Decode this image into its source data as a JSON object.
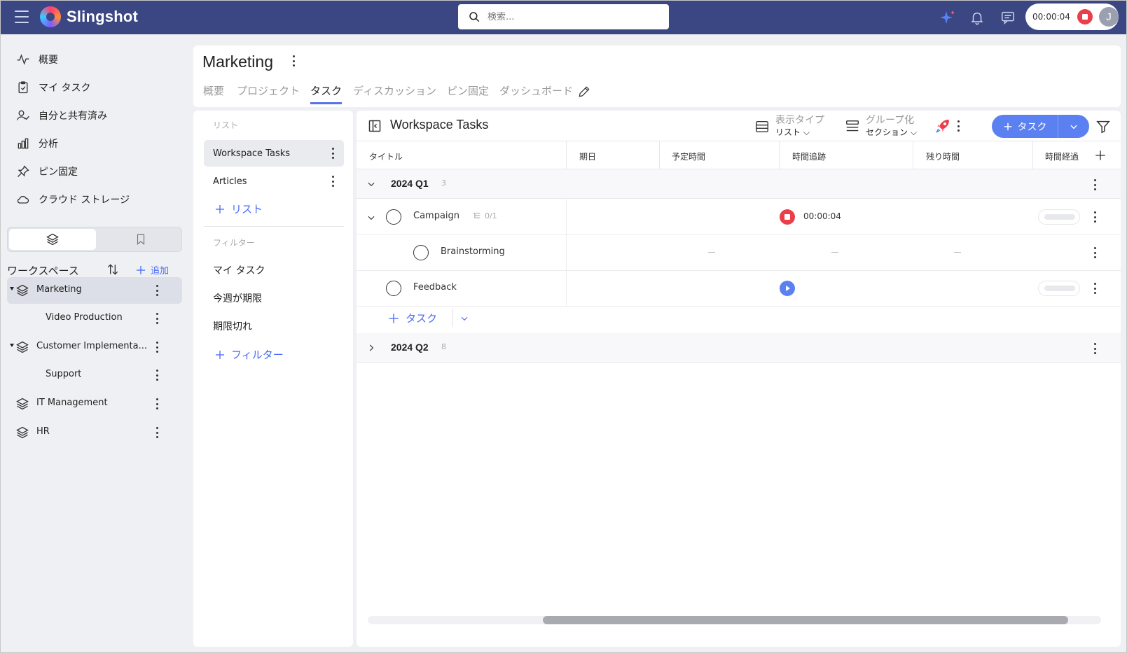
{
  "app": {
    "name": "Slingshot",
    "search_placeholder": "検索...",
    "timer": "00:00:04",
    "avatar_initial": "J"
  },
  "colors": {
    "topbar": "#3b4782",
    "accent": "#5b80f2",
    "record": "#ea3f4b"
  },
  "sidebar": {
    "nav": [
      {
        "label": "概要",
        "icon": "activity-icon"
      },
      {
        "label": "マイ タスク",
        "icon": "clipboard-check-icon"
      },
      {
        "label": "自分と共有済み",
        "icon": "user-check-icon"
      },
      {
        "label": "分析",
        "icon": "bar-chart-icon"
      },
      {
        "label": "ピン固定",
        "icon": "pin-icon"
      },
      {
        "label": "クラウド ストレージ",
        "icon": "cloud-icon"
      }
    ],
    "workspace_title": "ワークスペース",
    "add_label": "追加",
    "workspaces": [
      {
        "label": "Marketing",
        "active": true,
        "expanded": true,
        "sub": false
      },
      {
        "label": "Video Production",
        "sub": true
      },
      {
        "label": "Customer Implementa...",
        "expanded": true,
        "sub": false
      },
      {
        "label": "Support",
        "sub": true
      },
      {
        "label": "IT Management",
        "sub": false
      },
      {
        "label": "HR",
        "sub": false
      }
    ]
  },
  "header": {
    "title": "Marketing",
    "tabs": [
      {
        "label": "概要"
      },
      {
        "label": "プロジェクト"
      },
      {
        "label": "タスク",
        "active": true
      },
      {
        "label": "ディスカッション"
      },
      {
        "label": "ピン固定"
      },
      {
        "label": "ダッシュボード"
      }
    ]
  },
  "lists_panel": {
    "section_lists": "リスト",
    "lists": [
      {
        "label": "Workspace Tasks",
        "active": true
      },
      {
        "label": "Articles"
      }
    ],
    "add_list": "リスト",
    "section_filters": "フィルター",
    "filters": [
      "マイ タスク",
      "今週が期限",
      "期限切れ"
    ],
    "add_filter": "フィルター"
  },
  "tasks_panel": {
    "title": "Workspace Tasks",
    "view_type_label": "表示タイプ",
    "view_type_value": "リスト",
    "group_label": "グループ化",
    "group_value": "セクション",
    "new_task_label": "タスク",
    "columns": [
      "タイトル",
      "期日",
      "予定時間",
      "時間追跡",
      "残り時間",
      "時間経過"
    ],
    "groups": [
      {
        "name": "2024 Q1",
        "count": "3",
        "tasks": [
          {
            "name": "Campaign",
            "subtasks": "0/1",
            "tracking": "00:00:04",
            "recording": true
          },
          {
            "name": "Brainstorming",
            "subtask": true
          },
          {
            "name": "Feedback",
            "recording": false
          }
        ]
      },
      {
        "name": "2024 Q2",
        "count": "8"
      }
    ],
    "add_task_label": "タスク"
  }
}
